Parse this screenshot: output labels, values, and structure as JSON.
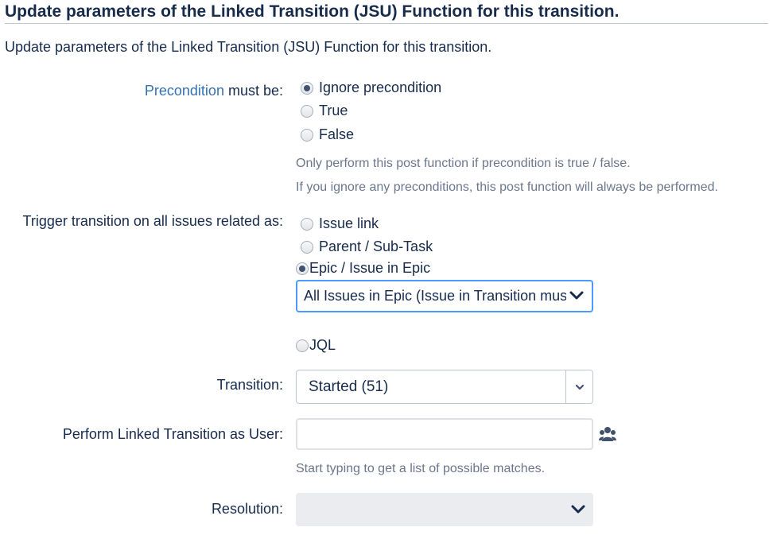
{
  "header": {
    "title": "Update parameters of the Linked Transition (JSU) Function for this transition."
  },
  "description": "Update parameters of the Linked Transition (JSU) Function for this transition.",
  "precondition": {
    "link_text": "Precondition",
    "label_suffix": " must be:",
    "options": [
      {
        "label": "Ignore precondition",
        "checked": true
      },
      {
        "label": "True",
        "checked": false
      },
      {
        "label": "False",
        "checked": false
      }
    ],
    "help1": "Only perform this post function if precondition is true / false.",
    "help2": "If you ignore any preconditions, this post function will always be performed."
  },
  "trigger": {
    "label": "Trigger transition on all issues related as:",
    "options": [
      {
        "label": "Issue link",
        "checked": false
      },
      {
        "label": "Parent / Sub-Task",
        "checked": false
      },
      {
        "label": "Epic / Issue in Epic",
        "checked": true
      },
      {
        "label": "JQL",
        "checked": false
      }
    ],
    "epic_select_value": "All Issues in Epic (Issue in Transition must"
  },
  "transition": {
    "label": "Transition:",
    "value": "Started (51)"
  },
  "user": {
    "label": "Perform Linked Transition as User:",
    "value": "",
    "placeholder": "",
    "help": "Start typing to get a list of possible matches.",
    "icon": "user-group-icon"
  },
  "resolution": {
    "label": "Resolution:",
    "value": ""
  },
  "colors": {
    "link": "#3572b0",
    "focus": "#4c9aff",
    "help_text": "#6b778c"
  }
}
